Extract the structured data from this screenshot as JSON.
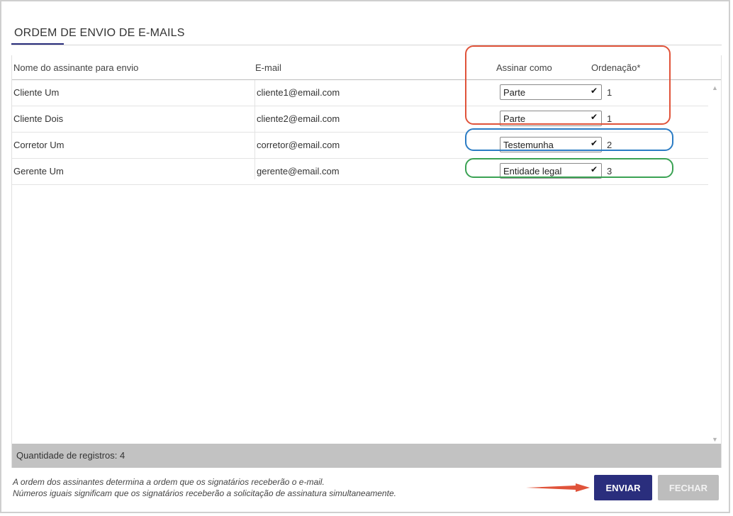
{
  "dialog": {
    "title": "ORDEM DE ENVIO DE E-MAILS"
  },
  "table": {
    "headers": {
      "name": "Nome do assinante para envio",
      "email": "E-mail",
      "sign_as": "Assinar como",
      "order": "Ordenação*"
    },
    "rows": [
      {
        "name": "Cliente Um",
        "email": "cliente1@email.com",
        "sign_as": "Parte",
        "order": "1"
      },
      {
        "name": "Cliente Dois",
        "email": "cliente2@email.com",
        "sign_as": "Parte",
        "order": "1"
      },
      {
        "name": "Corretor Um",
        "email": "corretor@email.com",
        "sign_as": "Testemunha",
        "order": "2"
      },
      {
        "name": "Gerente Um",
        "email": "gerente@email.com",
        "sign_as": "Entidade legal",
        "order": "3"
      }
    ],
    "record_count": "Quantidade de registros: 4"
  },
  "notes": {
    "line1": "A ordem dos assinantes determina a ordem que os signatários receberão o e-mail.",
    "line2": "Números iguais significam que os signatários receberão a solicitação de assinatura simultaneamente."
  },
  "buttons": {
    "send": "ENVIAR",
    "close": "FECHAR"
  },
  "icons": {
    "dropdown": "chevron-down-icon",
    "scroll_up": "scroll-up-arrow-icon",
    "scroll_down": "scroll-down-arrow-icon",
    "annotation_arrow": "arrow-right-icon"
  },
  "colors": {
    "primary": "#2a2e7d",
    "highlight_red": "#e0533a",
    "highlight_blue": "#2b7cc4",
    "highlight_green": "#3aa253",
    "disabled": "#bdbdbd"
  }
}
